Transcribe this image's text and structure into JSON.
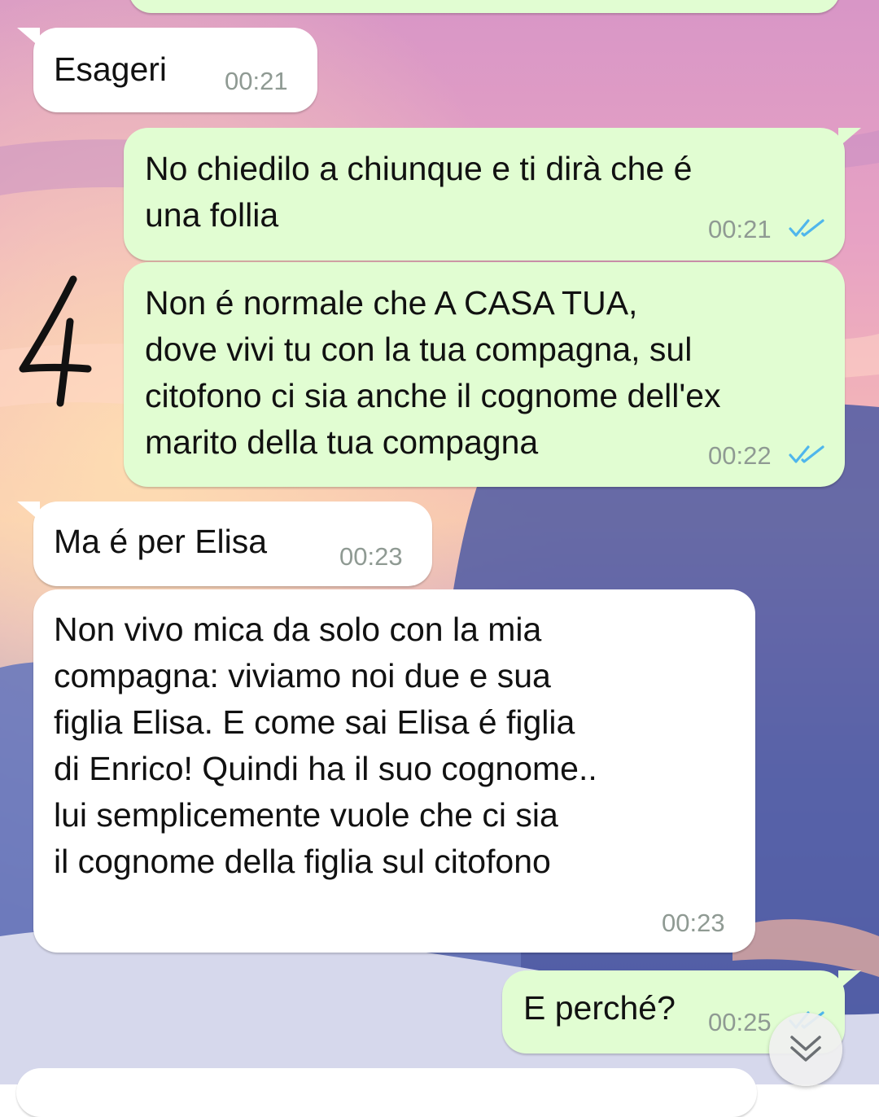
{
  "conversation": {
    "messages": [
      {
        "direction": "incoming",
        "text": "Esageri",
        "time": "00:21"
      },
      {
        "direction": "outgoing",
        "text": "No chiedilo a chiunque e ti dirà che é\nuna follia",
        "time": "00:21",
        "status": "read"
      },
      {
        "direction": "outgoing",
        "text": "Non é normale che A CASA TUA,\ndove vivi tu con la tua compagna, sul\ncitofono ci sia anche il cognome dell'ex\nmarito della tua compagna",
        "time": "00:22",
        "status": "read"
      },
      {
        "direction": "incoming",
        "text": "Ma é per Elisa",
        "time": "00:23"
      },
      {
        "direction": "incoming",
        "text": "Non vivo mica da solo con la mia\ncompagna: viviamo noi due e sua\nfiglia Elisa. E come sai Elisa é figlia\ndi Enrico! Quindi ha il suo cognome..\nlui semplicemente vuole che ci sia\nil cognome della figlia sul citofono",
        "time": "00:23"
      },
      {
        "direction": "outgoing",
        "text": "E perché?",
        "time": "00:25",
        "status": "read"
      }
    ]
  },
  "annotation": {
    "number": "4"
  },
  "colors": {
    "incoming_bubble": "#ffffff",
    "outgoing_bubble": "#e1fdd2",
    "read_tick": "#4fb6ec",
    "timestamp": "#8f9a93"
  },
  "icons": {
    "read_status": "double-check-icon",
    "scroll_down": "chevron-double-down-icon"
  }
}
